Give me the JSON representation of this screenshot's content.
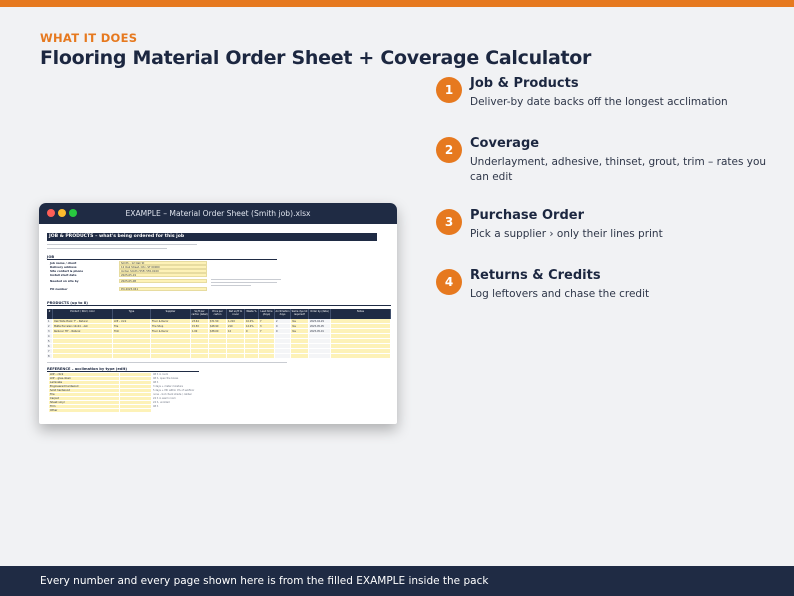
{
  "eyebrow": "WHAT IT DOES",
  "headline": "Flooring Material Order Sheet + Coverage Calculator",
  "features": [
    {
      "num": "1",
      "title": "Job & Products",
      "desc": "Deliver-by date backs off the longest acclimation"
    },
    {
      "num": "2",
      "title": "Coverage",
      "desc": "Underlayment, adhesive, thinset, grout, trim – rates you can edit"
    },
    {
      "num": "3",
      "title": "Purchase Order",
      "desc": "Pick a supplier › only their lines print"
    },
    {
      "num": "4",
      "title": "Returns & Credits",
      "desc": "Log leftovers and chase the credit"
    }
  ],
  "window": {
    "title": "EXAMPLE – Material Order Sheet (Smith job).xlsx",
    "sheet_title": "JOB & PRODUCTS – what's being ordered for this job",
    "job_label": "JOB",
    "job_fields": [
      {
        "label": "Job name / client",
        "value": "Smith – 12 Oak St"
      },
      {
        "label": "Delivery address",
        "value": "12 Oak Street, City, ST 00000"
      },
      {
        "label": "Site contact & phone",
        "value": "Jordan Smith (555) 555-0100"
      },
      {
        "label": "Install start date",
        "value": "2025-05-19"
      },
      {
        "label": "Needed on site by",
        "value": "2025-05-08"
      },
      {
        "label": "PO number",
        "value": "PO-2025-041"
      }
    ],
    "products_label": "PRODUCTS (up to 8)",
    "product_headers": [
      "#",
      "Product / SKU / color",
      "Type",
      "Supplier",
      "Sq ft per carton (label)",
      "Price per carton",
      "Net sq ft to cover",
      "Waste %",
      "Lead time (days)",
      "Acclimation days",
      "Same dye lot required?",
      "Order by (date)",
      "Notes"
    ],
    "product_rows": [
      [
        "1",
        "Oak Wide Plank 7\" – Natural",
        "LVP – click",
        "Floor & Decor",
        "23.64",
        "$71.50",
        "1,210",
        "10.0%",
        "7",
        "2",
        "Yes",
        "2025-04-29",
        ""
      ],
      [
        "2",
        "Matte Porcelain 12x24 – Ash",
        "Tile",
        "The Shop",
        "15.50",
        "$48.90",
        "210",
        "12.0%",
        "3",
        "0",
        "Yes",
        "2025-05-05",
        ""
      ],
      [
        "3",
        "Reducer 78\" – Natural",
        "Trim",
        "Floor & Decor",
        "1.00",
        "$38.00",
        "12",
        "0",
        "7",
        "0",
        "Yes",
        "2025-05-01",
        ""
      ],
      [
        "4",
        "",
        "",
        "",
        "",
        "",
        "",
        "",
        "",
        "",
        "",
        "",
        ""
      ],
      [
        "5",
        "",
        "",
        "",
        "",
        "",
        "",
        "",
        "",
        "",
        "",
        "",
        ""
      ],
      [
        "6",
        "",
        "",
        "",
        "",
        "",
        "",
        "",
        "",
        "",
        "",
        "",
        ""
      ],
      [
        "7",
        "",
        "",
        "",
        "",
        "",
        "",
        "",
        "",
        "",
        "",
        "",
        ""
      ],
      [
        "8",
        "",
        "",
        "",
        "",
        "",
        "",
        "",
        "",
        "",
        "",
        "",
        ""
      ]
    ],
    "reference_label": "REFERENCE – acclimation by type (edit)",
    "reference_rows": [
      {
        "type": "LVP – click",
        "note": "48 h in room"
      },
      {
        "type": "LVP – glue-down",
        "note": "48 h, open the boxes"
      },
      {
        "type": "Laminate",
        "note": "48 h"
      },
      {
        "type": "Engineered hardwood",
        "note": "3 days + meter moisture"
      },
      {
        "type": "Solid hardwood",
        "note": "5 days + MC within 4% of subfloor"
      },
      {
        "type": "Tile",
        "note": "none – but check shade / caliber"
      },
      {
        "type": "Carpet",
        "note": "24 h in warm room"
      },
      {
        "type": "Sheet vinyl",
        "note": "24 h, unrolled"
      },
      {
        "type": "Trim",
        "note": "48 h"
      },
      {
        "type": "Other",
        "note": ""
      }
    ]
  },
  "footer": "Every number and every page shown here is from the filled EXAMPLE inside the pack"
}
